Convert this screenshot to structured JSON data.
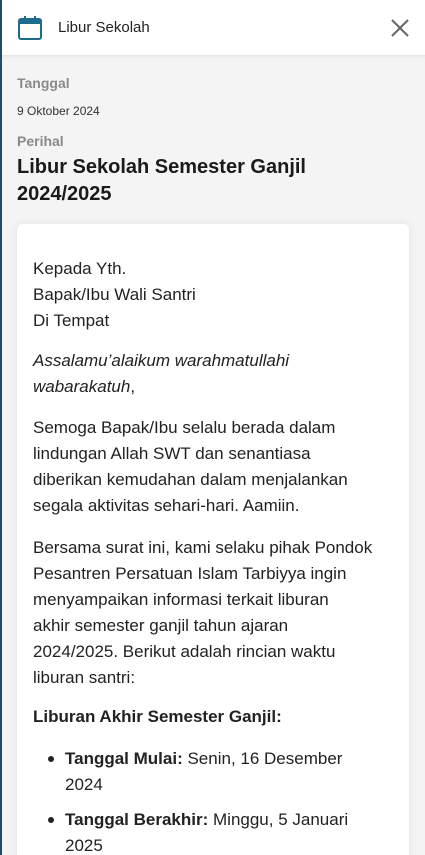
{
  "header": {
    "title": "Libur Sekolah",
    "calendar_icon": "calendar-icon",
    "close_icon": "close-icon",
    "accent_color": "#1f6b8c"
  },
  "meta": {
    "date_label": "Tanggal",
    "date_value": "9 Oktober 2024",
    "subject_label": "Perihal",
    "subject_line1": "Libur Sekolah Semester Ganjil",
    "subject_line2": "2024/2025"
  },
  "letter": {
    "greeting": [
      "Kepada Yth.",
      "Bapak/Ibu Wali Santri",
      "Di Tempat"
    ],
    "salam_line1": "Assalamu’alaikum warahmatullahi",
    "salam_line2": "wabarakatuh",
    "salam_comma": ",",
    "para1": [
      "Semoga Bapak/Ibu selalu berada dalam",
      "lindungan Allah SWT dan senantiasa",
      "diberikan kemudahan dalam menjalankan",
      "segala aktivitas sehari-hari. Aamiin."
    ],
    "para2": [
      "Bersama surat ini, kami selaku pihak Pondok",
      "Pesantren Persatuan Islam Tarbiyya ingin",
      "menyampaikan informasi terkait liburan",
      "akhir semester ganjil tahun ajaran",
      "2024/2025. Berikut adalah rincian waktu",
      "liburan santri:"
    ],
    "section_heading": "Liburan Akhir Semester Ganjil:",
    "items": [
      {
        "label": "Tanggal Mulai:",
        "value_line1": " Senin, 16 Desember",
        "value_line2": "2024"
      },
      {
        "label": "Tanggal Berakhir:",
        "value_line1": " Minggu, 5 Januari",
        "value_line2": "2025"
      }
    ]
  }
}
